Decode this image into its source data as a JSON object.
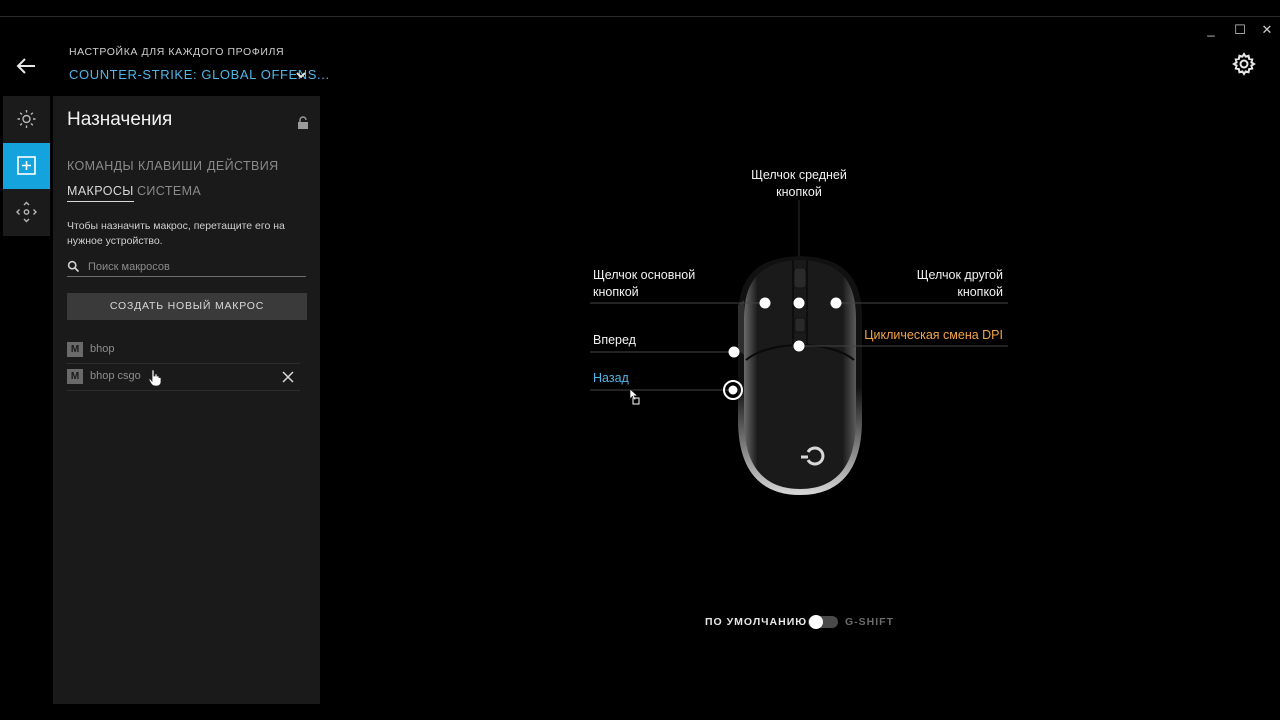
{
  "window": {
    "minimize_glyph": "_",
    "maximize_glyph": "☐",
    "close_glyph": "✕"
  },
  "header": {
    "profile_caption": "НАСТРОЙКА ДЛЯ КАЖДОГО ПРОФИЛЯ",
    "profile_name": "COUNTER-STRIKE: GLOBAL OFFENS..."
  },
  "rail": {
    "items": [
      {
        "icon": "lighting-icon"
      },
      {
        "icon": "assignments-icon"
      },
      {
        "icon": "dpi-move-icon"
      }
    ]
  },
  "panel": {
    "title": "Назначения",
    "tabs": [
      {
        "label": "КОМАНДЫ"
      },
      {
        "label": "КЛАВИШИ"
      },
      {
        "label": "ДЕЙСТВИЯ"
      },
      {
        "label": "МАКРОСЫ"
      },
      {
        "label": "СИСТЕМА"
      }
    ],
    "active_tab": "МАКРОСЫ",
    "hint": "Чтобы назначить макрос, перетащите его на нужное устройство.",
    "search_placeholder": "Поиск макросов",
    "create_button": "СОЗДАТЬ НОВЫЙ МАКРОС",
    "macros": [
      {
        "badge": "M",
        "name": "bhop"
      },
      {
        "badge": "M",
        "name": "bhop csgo"
      }
    ]
  },
  "device": {
    "labels": {
      "middle": "Щелчок средней кнопкой",
      "middle_line1": "Щелчок средней",
      "middle_line2": "кнопкой",
      "primary_line1": "Щелчок основной",
      "primary_line2": "кнопкой",
      "secondary_line1": "Щелчок другой",
      "secondary_line2": "кнопкой",
      "forward": "Вперед",
      "dpi": "Циклическая смена DPI",
      "back": "Назад"
    },
    "colors": {
      "accent_blue": "#4fb6e8",
      "dpi_orange": "#f3a446",
      "active_rail": "#14a3dc"
    }
  },
  "mode": {
    "default_label": "ПО УМОЛЧАНИЮ",
    "gshift_label": "G-SHIFT",
    "gshift_enabled": false
  }
}
